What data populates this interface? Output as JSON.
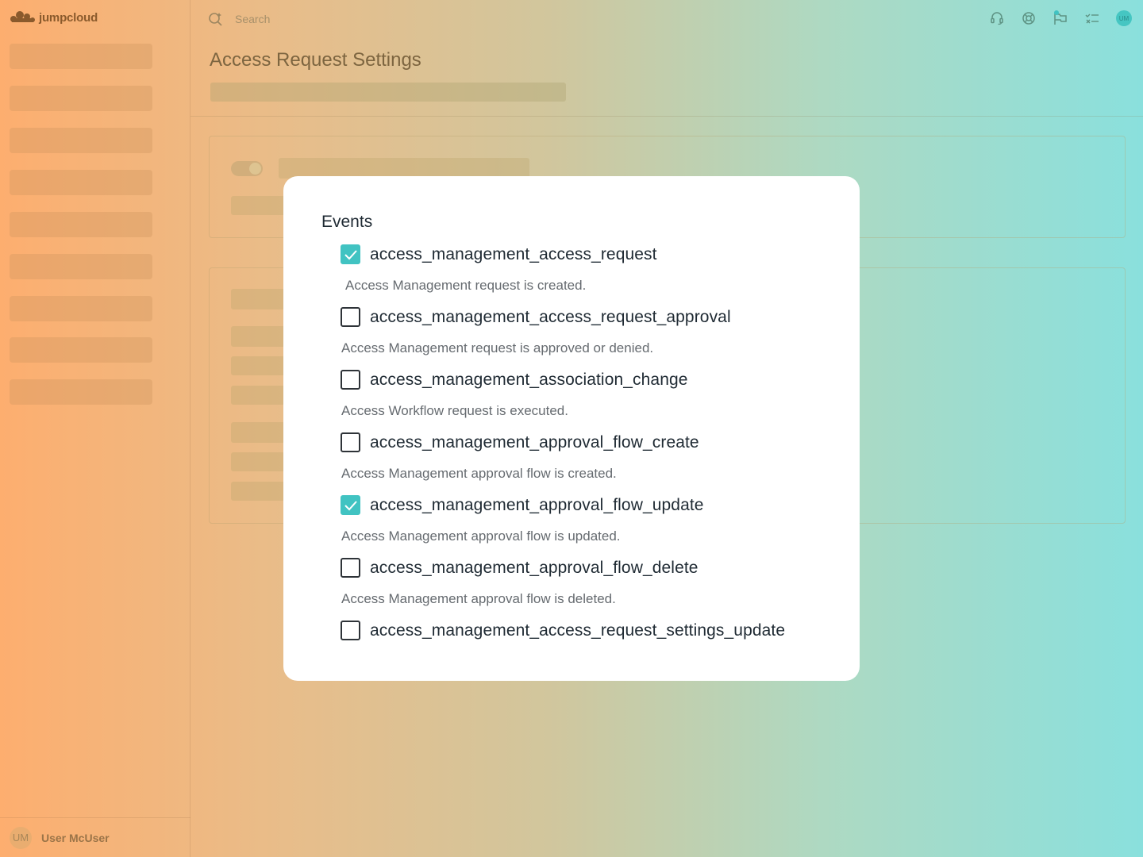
{
  "app": {
    "brand": "jumpcloud"
  },
  "topbar": {
    "search_placeholder": "Search",
    "icons": [
      "headset-icon",
      "help-lifebuoy-icon",
      "flag-icon",
      "checklist-icon"
    ],
    "avatar_initials": "UM"
  },
  "sidebar": {
    "user_initials": "UM",
    "user_name": "User McUser"
  },
  "page": {
    "title": "Access Request Settings"
  },
  "modal": {
    "title": "Events",
    "events": [
      {
        "name": "access_management_access_request",
        "checked": true,
        "description": "Access Management request is created."
      },
      {
        "name": "access_management_access_request_approval",
        "checked": false,
        "description": "Access Management request is approved or denied."
      },
      {
        "name": "access_management_association_change",
        "checked": false,
        "description": "Access Workflow request is executed."
      },
      {
        "name": "access_management_approval_flow_create",
        "checked": false,
        "description": "Access Management approval flow is created."
      },
      {
        "name": "access_management_approval_flow_update",
        "checked": true,
        "description": "Access Management approval flow is updated."
      },
      {
        "name": "access_management_approval_flow_delete",
        "checked": false,
        "description": "Access Management approval flow is deleted."
      },
      {
        "name": "access_management_access_request_settings_update",
        "checked": false,
        "description": ""
      }
    ]
  },
  "colors": {
    "accent": "#41c3c2",
    "modal_bg": "#ffffff",
    "text_primary": "#1f2a33",
    "text_secondary": "#666b70"
  }
}
